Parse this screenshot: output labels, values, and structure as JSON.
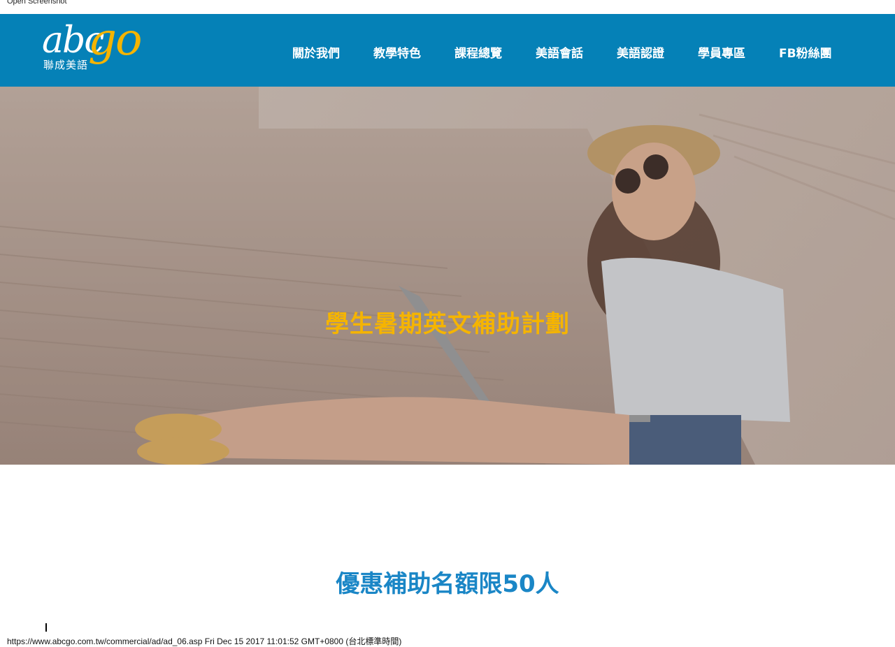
{
  "window": {
    "title": "Open Screenshot"
  },
  "logo": {
    "primary": "abc",
    "accent": "go",
    "subtitle": "聯成美語"
  },
  "nav": {
    "items": [
      {
        "label": "關於我們"
      },
      {
        "label": "教學特色"
      },
      {
        "label": "課程總覽"
      },
      {
        "label": "美語會話"
      },
      {
        "label": "美語認證"
      },
      {
        "label": "學員專區"
      },
      {
        "label": "FB粉絲團"
      }
    ]
  },
  "hero": {
    "title": "學生暑期英文補助計劃"
  },
  "promo": {
    "heading": "優惠補助名額限50人"
  },
  "status_bar": {
    "text": "https://www.abcgo.com.tw/commercial/ad/ad_06.asp Fri Dec 15 2017 11:01:52 GMT+0800 (台北標準時間)"
  },
  "colors": {
    "header": "#0581b7",
    "accent": "#f5b400",
    "promo": "#1a86c6"
  },
  "icons": {
    "hero": "photo-student-laptop"
  }
}
